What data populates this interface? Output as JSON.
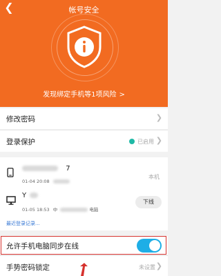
{
  "header": {
    "title": "帐号安全",
    "risk_text": "发现绑定手机等1项风险",
    "risk_chevron": ">"
  },
  "settings": {
    "change_password": "修改密码",
    "login_protection": "登录保护",
    "login_protection_status": "已启用",
    "allow_sync": "允许手机电脑同步在线",
    "allow_sync_enabled": true,
    "gesture_lock": "手势密码锁定",
    "gesture_lock_status": "未设置"
  },
  "devices": [
    {
      "name_suffix": "7",
      "time": "01-04 20:08",
      "tag": "本机"
    },
    {
      "name_prefix": "Y",
      "time": "01-05 18:53",
      "location_prefix": "中",
      "location_suffix": "电脑",
      "action": "下线"
    }
  ],
  "recent_login": "最近登录记录..."
}
